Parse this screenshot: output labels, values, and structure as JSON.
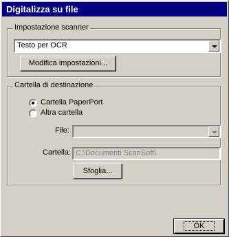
{
  "window": {
    "title": "Digitalizza su file"
  },
  "scanner": {
    "group_label": "Impostazione scanner",
    "mode_value": "Testo per OCR",
    "modify_button": "Modifica impostazioni..."
  },
  "destination": {
    "group_label": "Cartella di destinazione",
    "option_paperport": "Cartella PaperPort",
    "option_other": "Altra cartella",
    "selected_option": "paperport",
    "file_label": "File:",
    "file_value": "",
    "folder_label": "Cartella:",
    "folder_value": "C:\\Documenti ScanSoft\\",
    "browse_button": "Sfoglia..."
  },
  "footer": {
    "ok_button": "OK"
  },
  "colors": {
    "titlebar": "#000080",
    "dialog": "#d4d0c8"
  },
  "icons": {
    "dropdown": "chevron-down-icon"
  }
}
